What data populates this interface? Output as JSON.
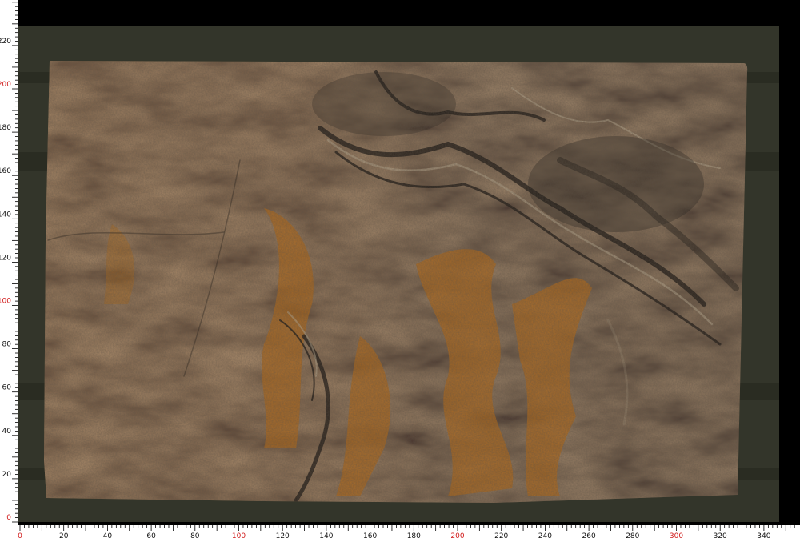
{
  "colors": {
    "background": "#000000",
    "backdrop": "#33352a",
    "backdrop_band": "#2a2c22",
    "ruler_bg": "#ffffff",
    "ruler_tick": "#000000",
    "label_normal": "#111111",
    "label_accent": "#d11a1a",
    "slab_base": "#5a4630",
    "rust": "#b06a1c",
    "dark_vein": "#1e1a16",
    "light_vein": "#b8aa90"
  },
  "ruler": {
    "x_labels": [
      {
        "text": "0",
        "accent": true
      },
      {
        "text": "20",
        "accent": false
      },
      {
        "text": "40",
        "accent": false
      },
      {
        "text": "60",
        "accent": false
      },
      {
        "text": "80",
        "accent": false
      },
      {
        "text": "100",
        "accent": true
      },
      {
        "text": "120",
        "accent": false
      },
      {
        "text": "140",
        "accent": false
      },
      {
        "text": "160",
        "accent": false
      },
      {
        "text": "180",
        "accent": false
      },
      {
        "text": "200",
        "accent": true
      },
      {
        "text": "220",
        "accent": false
      },
      {
        "text": "240",
        "accent": false
      },
      {
        "text": "260",
        "accent": false
      },
      {
        "text": "280",
        "accent": false
      },
      {
        "text": "300",
        "accent": true
      },
      {
        "text": "320",
        "accent": false
      },
      {
        "text": "340",
        "accent": false
      }
    ],
    "y_labels": [
      {
        "text": "0",
        "accent": true
      },
      {
        "text": "20",
        "accent": false
      },
      {
        "text": "40",
        "accent": false
      },
      {
        "text": "60",
        "accent": false
      },
      {
        "text": "80",
        "accent": false
      },
      {
        "text": "100",
        "accent": true
      },
      {
        "text": "120",
        "accent": false
      },
      {
        "text": "140",
        "accent": false
      },
      {
        "text": "160",
        "accent": false
      },
      {
        "text": "180",
        "accent": false
      },
      {
        "text": "200",
        "accent": true
      },
      {
        "text": "220",
        "accent": false
      }
    ]
  }
}
